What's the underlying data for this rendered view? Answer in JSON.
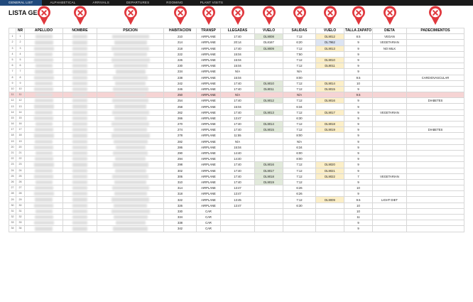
{
  "tabs": [
    {
      "label": "GENERAL LIST",
      "active": true
    },
    {
      "label": "ALPHABETICAL",
      "active": false
    },
    {
      "label": "ARRIVALS",
      "active": false
    },
    {
      "label": "DEPARTURES",
      "active": false
    },
    {
      "label": "ROOMING",
      "active": false
    },
    {
      "label": "PLANT VISITS",
      "active": false
    }
  ],
  "title": "LISTA GENE",
  "headers": [
    "",
    "NR",
    "APELLIDO",
    "NOMBRE",
    "PSICIÓN",
    "HABITACIÓN",
    "TRANSP",
    "LLEGADAS",
    "VUELO",
    "SALIDAS",
    "VUELO",
    "TALLA ZAPATO",
    "DIETA",
    "PADECIMIENTOS"
  ],
  "pin_icon": "close-marker-icon",
  "pin_color": "#e0383e",
  "highlight_color": "#f6d4d4",
  "rows": [
    {
      "r": "1",
      "nr": "1",
      "hab": "210",
      "tr": "AIRPLANE",
      "ll": "17:40",
      "v1": "DL9008",
      "v1c": "grn",
      "sal": "7:12",
      "v2": "DL9012",
      "v2c": "yel",
      "tz": "8.5",
      "di": "VEGAN",
      "pa": ""
    },
    {
      "r": "2",
      "nr": "2",
      "hab": "214",
      "tr": "AIRPLANE",
      "ll": "20:14",
      "v1": "DL8167",
      "v1c": "",
      "sal": "6:20",
      "v2": "DL7962",
      "v2c": "blu",
      "tz": "9",
      "di": "VEGETARIAN",
      "pa": ""
    },
    {
      "r": "3",
      "nr": "3",
      "hab": "218",
      "tr": "AIRPLANE",
      "ll": "17:40",
      "v1": "DL9009",
      "v1c": "grn",
      "sal": "7:12",
      "v2": "DL9013",
      "v2c": "yel",
      "tz": "9",
      "di": "NO MILK",
      "pa": ""
    },
    {
      "r": "4",
      "nr": "4",
      "hab": "222",
      "tr": "AIRPLANE",
      "ll": "15:04",
      "v1": "",
      "v1c": "",
      "sal": "7:50",
      "v2": "",
      "v2c": "",
      "tz": "9",
      "di": "",
      "pa": ""
    },
    {
      "r": "5",
      "nr": "5",
      "hab": "226",
      "tr": "AIRPLANE",
      "ll": "15:04",
      "v1": "",
      "v1c": "",
      "sal": "7:12",
      "v2": "DL9010",
      "v2c": "yel",
      "tz": "9",
      "di": "",
      "pa": ""
    },
    {
      "r": "6",
      "nr": "6",
      "hab": "230",
      "tr": "AIRPLANE",
      "ll": "15:04",
      "v1": "",
      "v1c": "",
      "sal": "7:12",
      "v2": "DL9011",
      "v2c": "yel",
      "tz": "9",
      "di": "",
      "pa": ""
    },
    {
      "r": "7",
      "nr": "7",
      "hab": "234",
      "tr": "AIRPLANE",
      "ll": "N/A",
      "v1": "",
      "v1c": "",
      "sal": "N/A",
      "v2": "",
      "v2c": "",
      "tz": "9",
      "di": "",
      "pa": ""
    },
    {
      "r": "8",
      "nr": "8",
      "hab": "238",
      "tr": "AIRPLANE",
      "ll": "15:04",
      "v1": "",
      "v1c": "",
      "sal": "8:00",
      "v2": "",
      "v2c": "",
      "tz": "9.5",
      "di": "",
      "pa": "CARDIOVASCULAR"
    },
    {
      "r": "9",
      "nr": "9",
      "hab": "242",
      "tr": "AIRPLANE",
      "ll": "17:40",
      "v1": "DL9010",
      "v1c": "grn",
      "sal": "7:12",
      "v2": "DL9014",
      "v2c": "yel",
      "tz": "10",
      "di": "",
      "pa": ""
    },
    {
      "r": "10",
      "nr": "10",
      "hab": "246",
      "tr": "AIRPLANE",
      "ll": "17:40",
      "v1": "DL9011",
      "v1c": "grn",
      "sal": "7:12",
      "v2": "DL9015",
      "v2c": "yel",
      "tz": "9",
      "di": "",
      "pa": ""
    },
    {
      "r": "11",
      "nr": "11",
      "hab": "250",
      "tr": "AIRPLANE",
      "ll": "N/A",
      "v1": "",
      "v1c": "",
      "sal": "N/A",
      "v2": "",
      "v2c": "",
      "tz": "9.5",
      "di": "",
      "pa": "",
      "hl": true
    },
    {
      "r": "12",
      "nr": "12",
      "hab": "254",
      "tr": "AIRPLANE",
      "ll": "17:40",
      "v1": "DL9012",
      "v1c": "grn",
      "sal": "7:12",
      "v2": "DL9016",
      "v2c": "yel",
      "tz": "9",
      "di": "",
      "pa": "DIABETES"
    },
    {
      "r": "13",
      "nr": "13",
      "hab": "258",
      "tr": "AIRPLANE",
      "ll": "15:04",
      "v1": "",
      "v1c": "",
      "sal": "6:34",
      "v2": "",
      "v2c": "",
      "tz": "9",
      "di": "",
      "pa": ""
    },
    {
      "r": "14",
      "nr": "14",
      "hab": "262",
      "tr": "AIRPLANE",
      "ll": "17:40",
      "v1": "DL9013",
      "v1c": "grn",
      "sal": "7:12",
      "v2": "DL9017",
      "v2c": "yel",
      "tz": "9",
      "di": "VEGETARIAN",
      "pa": ""
    },
    {
      "r": "15",
      "nr": "15",
      "hab": "266",
      "tr": "AIRPLANE",
      "ll": "13:47",
      "v1": "",
      "v1c": "",
      "sal": "6:30",
      "v2": "",
      "v2c": "",
      "tz": "9",
      "di": "",
      "pa": ""
    },
    {
      "r": "16",
      "nr": "16",
      "hab": "270",
      "tr": "AIRPLANE",
      "ll": "17:40",
      "v1": "DL9014",
      "v1c": "grn",
      "sal": "7:12",
      "v2": "DL9018",
      "v2c": "yel",
      "tz": "9",
      "di": "",
      "pa": ""
    },
    {
      "r": "17",
      "nr": "17",
      "hab": "274",
      "tr": "AIRPLANE",
      "ll": "17:40",
      "v1": "DL9015",
      "v1c": "grn",
      "sal": "7:12",
      "v2": "DL9019",
      "v2c": "yel",
      "tz": "9",
      "di": "",
      "pa": "DIABETES"
    },
    {
      "r": "18",
      "nr": "18",
      "hab": "278",
      "tr": "AIRPLANE",
      "ll": "11:55",
      "v1": "",
      "v1c": "",
      "sal": "8:00",
      "v2": "",
      "v2c": "",
      "tz": "9",
      "di": "",
      "pa": ""
    },
    {
      "r": "19",
      "nr": "19",
      "hab": "282",
      "tr": "AIRPLANE",
      "ll": "N/A",
      "v1": "",
      "v1c": "",
      "sal": "N/A",
      "v2": "",
      "v2c": "",
      "tz": "9",
      "di": "",
      "pa": ""
    },
    {
      "r": "20",
      "nr": "20",
      "hab": "286",
      "tr": "AIRPLANE",
      "ll": "15:04",
      "v1": "",
      "v1c": "",
      "sal": "6:34",
      "v2": "",
      "v2c": "",
      "tz": "9",
      "di": "",
      "pa": ""
    },
    {
      "r": "21",
      "nr": "21",
      "hab": "290",
      "tr": "AIRPLANE",
      "ll": "14:40",
      "v1": "",
      "v1c": "",
      "sal": "6:00",
      "v2": "",
      "v2c": "",
      "tz": "9",
      "di": "",
      "pa": ""
    },
    {
      "r": "22",
      "nr": "22",
      "hab": "294",
      "tr": "AIRPLANE",
      "ll": "14:40",
      "v1": "",
      "v1c": "",
      "sal": "8:00",
      "v2": "",
      "v2c": "",
      "tz": "9",
      "di": "",
      "pa": ""
    },
    {
      "r": "23",
      "nr": "23",
      "hab": "298",
      "tr": "AIRPLANE",
      "ll": "17:40",
      "v1": "DL9016",
      "v1c": "grn",
      "sal": "7:12",
      "v2": "DL9020",
      "v2c": "yel",
      "tz": "9",
      "di": "",
      "pa": ""
    },
    {
      "r": "24",
      "nr": "24",
      "hab": "302",
      "tr": "AIRPLANE",
      "ll": "17:40",
      "v1": "DL9017",
      "v1c": "grn",
      "sal": "7:12",
      "v2": "DL9021",
      "v2c": "yel",
      "tz": "9",
      "di": "",
      "pa": ""
    },
    {
      "r": "25",
      "nr": "25",
      "hab": "306",
      "tr": "AIRPLANE",
      "ll": "17:40",
      "v1": "DL9018",
      "v1c": "grn",
      "sal": "7:12",
      "v2": "DL9022",
      "v2c": "yel",
      "tz": "7",
      "di": "VEGETARIAN",
      "pa": ""
    },
    {
      "r": "26",
      "nr": "26",
      "hab": "310",
      "tr": "AIRPLANE",
      "ll": "17:40",
      "v1": "DL9019",
      "v1c": "grn",
      "sal": "7:12",
      "v2": "",
      "v2c": "",
      "tz": "9",
      "di": "",
      "pa": ""
    },
    {
      "r": "27",
      "nr": "27",
      "hab": "314",
      "tr": "AIRPLANE",
      "ll": "13:47",
      "v1": "",
      "v1c": "",
      "sal": "6:26",
      "v2": "",
      "v2c": "",
      "tz": "10",
      "di": "",
      "pa": ""
    },
    {
      "r": "28",
      "nr": "28",
      "hab": "318",
      "tr": "AIRPLANE",
      "ll": "13:47",
      "v1": "",
      "v1c": "",
      "sal": "6:26",
      "v2": "",
      "v2c": "",
      "tz": "9",
      "di": "",
      "pa": ""
    },
    {
      "r": "29",
      "nr": "29",
      "hab": "322",
      "tr": "AIRPLANE",
      "ll": "13:45",
      "v1": "",
      "v1c": "",
      "sal": "7:12",
      "v2": "DL9009",
      "v2c": "yel",
      "tz": "9.5",
      "di": "LIGHT DIET",
      "pa": ""
    },
    {
      "r": "30",
      "nr": "30",
      "hab": "326",
      "tr": "AIRPLANE",
      "ll": "13:47",
      "v1": "",
      "v1c": "",
      "sal": "6:30",
      "v2": "",
      "v2c": "",
      "tz": "10",
      "di": "",
      "pa": ""
    },
    {
      "r": "31",
      "nr": "31",
      "hab": "330",
      "tr": "CAR",
      "ll": "",
      "v1": "",
      "v1c": "",
      "sal": "",
      "v2": "",
      "v2c": "",
      "tz": "10",
      "di": "",
      "pa": ""
    },
    {
      "r": "32",
      "nr": "32",
      "hab": "334",
      "tr": "CAR",
      "ll": "",
      "v1": "",
      "v1c": "",
      "sal": "",
      "v2": "",
      "v2c": "",
      "tz": "11",
      "di": "",
      "pa": ""
    },
    {
      "r": "33",
      "nr": "33",
      "hab": "338",
      "tr": "CAR",
      "ll": "",
      "v1": "",
      "v1c": "",
      "sal": "",
      "v2": "",
      "v2c": "",
      "tz": "9",
      "di": "",
      "pa": ""
    },
    {
      "r": "34",
      "nr": "34",
      "hab": "342",
      "tr": "CAR",
      "ll": "",
      "v1": "",
      "v1c": "",
      "sal": "",
      "v2": "",
      "v2c": "",
      "tz": "9",
      "di": "",
      "pa": ""
    }
  ]
}
